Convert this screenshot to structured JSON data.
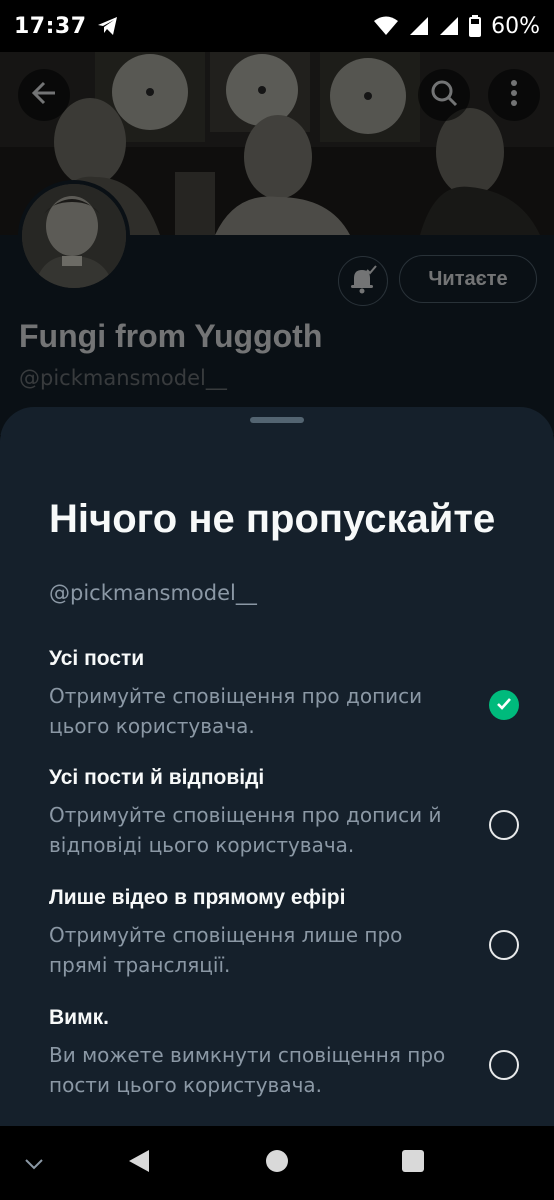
{
  "status_bar": {
    "time": "17:37",
    "battery": "60%",
    "icons": [
      "telegram-icon",
      "wifi-icon",
      "signal-icon",
      "signal-icon",
      "battery-icon"
    ]
  },
  "header": {
    "back_icon": "arrow-left-icon",
    "search_icon": "search-icon",
    "more_icon": "more-vertical-icon"
  },
  "profile": {
    "display_name": "Fungi from Yuggoth",
    "handle": "@pickmansmodel__",
    "notify_icon": "bell-check-icon",
    "follow_label": "Читаєте"
  },
  "sheet": {
    "title": "Нічого не пропускайте",
    "handle": "@pickmansmodel__",
    "options": [
      {
        "title": "Усі пости",
        "description": "Отримуйте сповіщення про дописи цього користувача.",
        "selected": true
      },
      {
        "title": "Усі пости й відповіді",
        "description": "Отримуйте сповіщення про дописи й відповіді цього користувача.",
        "selected": false
      },
      {
        "title": "Лише відео в прямому ефірі",
        "description": "Отримуйте сповіщення лише про прямі трансляції.",
        "selected": false
      },
      {
        "title": "Вимк.",
        "description": "Ви можете вимкнути сповіщення про пости цього користувача.",
        "selected": false
      }
    ]
  },
  "nav_bar": {
    "icons": [
      "chevron-down-icon",
      "back-triangle-icon",
      "home-circle-icon",
      "recents-square-icon"
    ]
  },
  "colors": {
    "background": "#15202b",
    "accent_green": "#00ba7c",
    "muted_text": "#8b98a5"
  }
}
